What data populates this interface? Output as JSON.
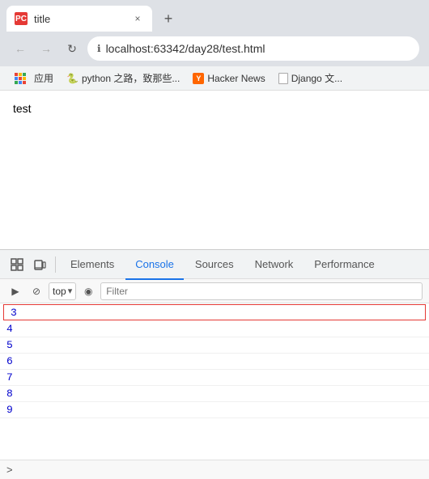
{
  "browser": {
    "tab": {
      "favicon_label": "PC",
      "title": "title",
      "close_label": "×",
      "new_tab_label": "+"
    },
    "nav": {
      "back_label": "←",
      "forward_label": "→",
      "reload_label": "↻",
      "url": "localhost:63342/day28/test.html",
      "lock_icon": "ℹ"
    },
    "bookmarks": [
      {
        "id": "apps",
        "label": "应用",
        "type": "apps"
      },
      {
        "id": "python",
        "label": "python 之路，致那些...",
        "type": "text"
      },
      {
        "id": "hackernews",
        "label": "Hacker News",
        "type": "y"
      },
      {
        "id": "django",
        "label": "Django 文...",
        "type": "doc"
      }
    ]
  },
  "page": {
    "content": "test"
  },
  "devtools": {
    "toolbar": {
      "inspect_icon": "⊡",
      "device_icon": "▭",
      "tabs": [
        "Elements",
        "Console",
        "Sources",
        "Network",
        "Performance"
      ],
      "active_tab": "Console"
    },
    "console_toolbar": {
      "play_icon": "▶",
      "no_icon": "⊘",
      "context_label": "top",
      "dropdown_icon": "▾",
      "eye_icon": "◉",
      "filter_placeholder": "Filter"
    },
    "console_output": {
      "rows": [
        {
          "value": "3",
          "highlighted": true
        },
        {
          "value": "4",
          "highlighted": false
        },
        {
          "value": "5",
          "highlighted": false
        },
        {
          "value": "6",
          "highlighted": false
        },
        {
          "value": "7",
          "highlighted": false
        },
        {
          "value": "8",
          "highlighted": false
        },
        {
          "value": "9",
          "highlighted": false
        }
      ]
    },
    "bottom_prompt": ">"
  }
}
